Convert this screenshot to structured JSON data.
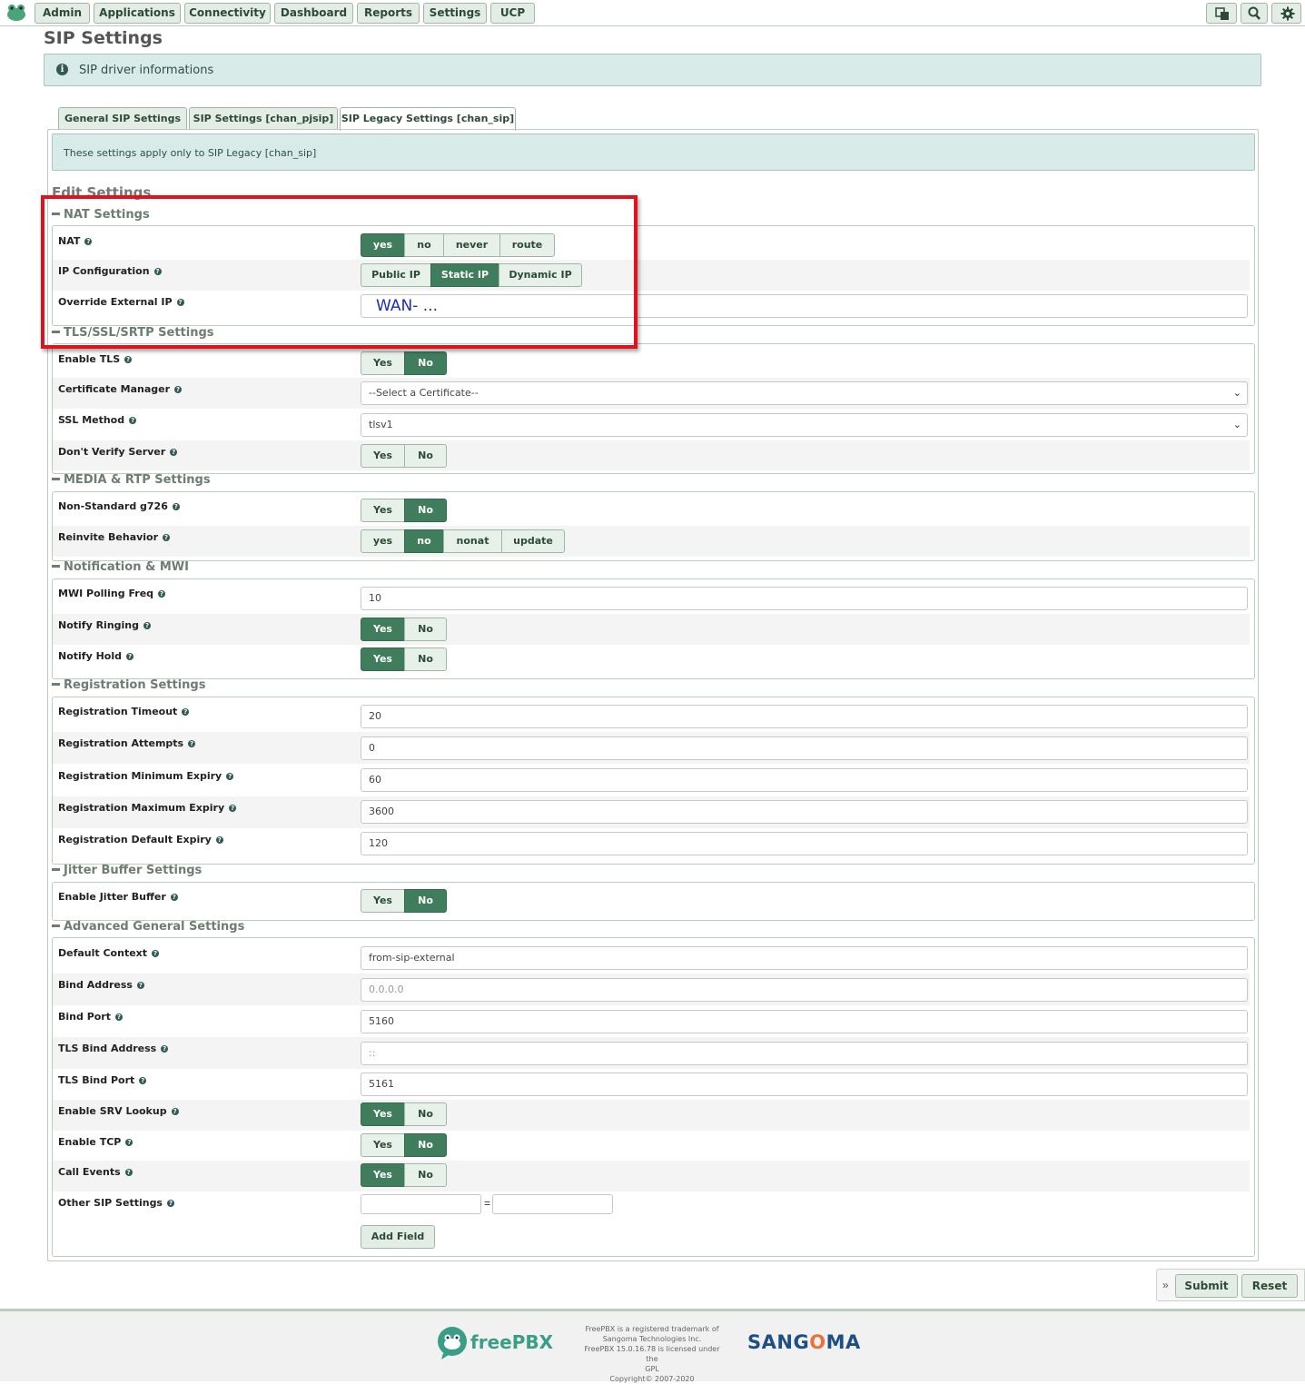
{
  "nav": {
    "items": [
      {
        "label": "Admin"
      },
      {
        "label": "Applications"
      },
      {
        "label": "Connectivity"
      },
      {
        "label": "Dashboard"
      },
      {
        "label": "Reports"
      },
      {
        "label": "Settings"
      },
      {
        "label": "UCP"
      }
    ],
    "icons": [
      "language-icon",
      "search-icon",
      "gear-icon"
    ]
  },
  "page_title": "SIP Settings",
  "info_text": "SIP driver informations",
  "tabs": [
    {
      "label": "General SIP Settings",
      "active": false
    },
    {
      "label": "SIP Settings [chan_pjsip]",
      "active": false
    },
    {
      "label": "SIP Legacy Settings [chan_sip]",
      "active": true
    }
  ],
  "apply_text": "These settings apply only to SIP Legacy [chan_sip]",
  "edit_title": "Edit Settings",
  "sections": {
    "nat": {
      "title": "NAT Settings",
      "nat": {
        "label": "NAT",
        "options": [
          "yes",
          "no",
          "never",
          "route"
        ],
        "selected": "yes"
      },
      "ip_config": {
        "label": "IP Configuration",
        "options": [
          "Public IP",
          "Static IP",
          "Dynamic IP"
        ],
        "selected": "Static IP"
      },
      "override_ip": {
        "label": "Override External IP",
        "value": "WAN- ..."
      }
    },
    "tls": {
      "title": "TLS/SSL/SRTP Settings",
      "enable_tls": {
        "label": "Enable TLS",
        "options": [
          "Yes",
          "No"
        ],
        "selected": "No"
      },
      "cert_manager": {
        "label": "Certificate Manager",
        "value": "--Select a Certificate--"
      },
      "ssl_method": {
        "label": "SSL Method",
        "value": "tlsv1"
      },
      "dont_verify": {
        "label": "Don't Verify Server",
        "options": [
          "Yes",
          "No"
        ],
        "selected": ""
      }
    },
    "media": {
      "title": "MEDIA & RTP Settings",
      "g726": {
        "label": "Non-Standard g726",
        "options": [
          "Yes",
          "No"
        ],
        "selected": "No"
      },
      "reinvite": {
        "label": "Reinvite Behavior",
        "options": [
          "yes",
          "no",
          "nonat",
          "update"
        ],
        "selected": "no"
      }
    },
    "mwi": {
      "title": "Notification & MWI",
      "polling": {
        "label": "MWI Polling Freq",
        "value": "10"
      },
      "ringing": {
        "label": "Notify Ringing",
        "options": [
          "Yes",
          "No"
        ],
        "selected": "Yes"
      },
      "hold": {
        "label": "Notify Hold",
        "options": [
          "Yes",
          "No"
        ],
        "selected": "Yes"
      }
    },
    "registration": {
      "title": "Registration Settings",
      "timeout": {
        "label": "Registration Timeout",
        "value": "20"
      },
      "attempts": {
        "label": "Registration Attempts",
        "value": "0"
      },
      "min_expiry": {
        "label": "Registration Minimum Expiry",
        "value": "60"
      },
      "max_expiry": {
        "label": "Registration Maximum Expiry",
        "value": "3600"
      },
      "default_expiry": {
        "label": "Registration Default Expiry",
        "value": "120"
      }
    },
    "jitter": {
      "title": "Jitter Buffer Settings",
      "enable": {
        "label": "Enable Jitter Buffer",
        "options": [
          "Yes",
          "No"
        ],
        "selected": "No"
      }
    },
    "advanced": {
      "title": "Advanced General Settings",
      "context": {
        "label": "Default Context",
        "value": "from-sip-external"
      },
      "bind_address": {
        "label": "Bind Address",
        "placeholder": "0.0.0.0"
      },
      "bind_port": {
        "label": "Bind Port",
        "value": "5160"
      },
      "tls_bind_address": {
        "label": "TLS Bind Address",
        "placeholder": "::"
      },
      "tls_bind_port": {
        "label": "TLS Bind Port",
        "value": "5161"
      },
      "srv": {
        "label": "Enable SRV Lookup",
        "options": [
          "Yes",
          "No"
        ],
        "selected": "Yes"
      },
      "tcp": {
        "label": "Enable TCP",
        "options": [
          "Yes",
          "No"
        ],
        "selected": "No"
      },
      "call_events": {
        "label": "Call Events",
        "options": [
          "Yes",
          "No"
        ],
        "selected": "Yes"
      },
      "other": {
        "label": "Other SIP Settings",
        "equals": "="
      },
      "add_field": "Add Field"
    }
  },
  "actions": {
    "submit": "Submit",
    "reset": "Reset",
    "chevron": "»"
  },
  "footer": {
    "brand": "freePBX",
    "lines": [
      "FreePBX is a registered trademark of",
      "Sangoma Technologies Inc.",
      "FreePBX 15.0.16.78 is licensed under the",
      "GPL",
      "Copyright© 2007-2020"
    ],
    "sangoma": {
      "pre": "SANG",
      "mid": "O",
      "post": "MA"
    }
  },
  "colors": {
    "accent": "#3f7d5c",
    "info_bg": "#d9ebe9",
    "highlight": "#e1121b"
  }
}
